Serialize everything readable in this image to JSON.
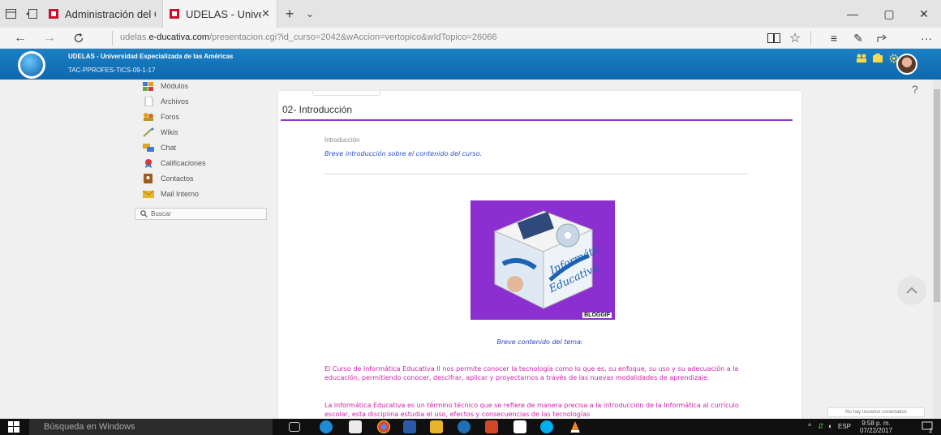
{
  "browser": {
    "tabs": [
      {
        "label": "Administración del Campus",
        "active": false
      },
      {
        "label": "UDELAS - Universidad E",
        "active": true
      }
    ],
    "new_tab_glyph": "+",
    "tab_menu_glyph": "⌄",
    "url_prefix": "udelas.",
    "url_domain": "e-ducativa.com",
    "url_path": "/presentacion.cgi?id_curso=2042&wAccion=vertopico&wIdTopico=26066",
    "window_controls": [
      "—",
      "▢",
      "✕"
    ]
  },
  "app": {
    "campus_name": "UDELAS - Universidad Especializada de las Américas",
    "course_code": "TAC-PPROFES-TICS-09-1-17",
    "brand_color": "#1479bd",
    "help_glyph": "?"
  },
  "sidebar": {
    "items": [
      {
        "label": "Módulos",
        "icon": "modules-icon"
      },
      {
        "label": "Archivos",
        "icon": "files-icon"
      },
      {
        "label": "Foros",
        "icon": "forums-icon"
      },
      {
        "label": "Wikis",
        "icon": "wikis-icon"
      },
      {
        "label": "Chat",
        "icon": "chat-icon"
      },
      {
        "label": "Calificaciones",
        "icon": "grades-icon"
      },
      {
        "label": "Contactos",
        "icon": "contacts-icon"
      },
      {
        "label": "Mail Interno",
        "icon": "mail-icon"
      }
    ],
    "search_label": "Buscar"
  },
  "content": {
    "title": "02- Introducción",
    "section_label": "Introducción",
    "intro": "Breve introducción sobre el contenido del curso.",
    "image_watermark": "BLOGGIF",
    "image_caption_parts": [
      "Informática",
      "Educativa"
    ],
    "subheading": "Breve contenido del tema:",
    "paragraph1": "El Curso de Informática Educativa II nos permite conocer la tecnología como lo que es, su enfoque, su uso y su adecuación a la educación, permitiendo conocer, descifrar, aplicar y proyectarnos a través de las nuevas modalidades de aprendizaje.",
    "paragraph2": "La informática Educativa es un término técnico que se refiere de manera precisa a la introducción de la Informática al currículo escolar, esta disciplina estudia el uso, efectos y consecuencias de las tecnologías",
    "accent_color": "#8a3cc4"
  },
  "online_status": "No hay usuarios conectados",
  "taskbar": {
    "search_placeholder": "Búsqueda en Windows",
    "language": "ESP",
    "time": "9:58 p. m.",
    "date": "07/22/2017",
    "notification_count": "2"
  }
}
